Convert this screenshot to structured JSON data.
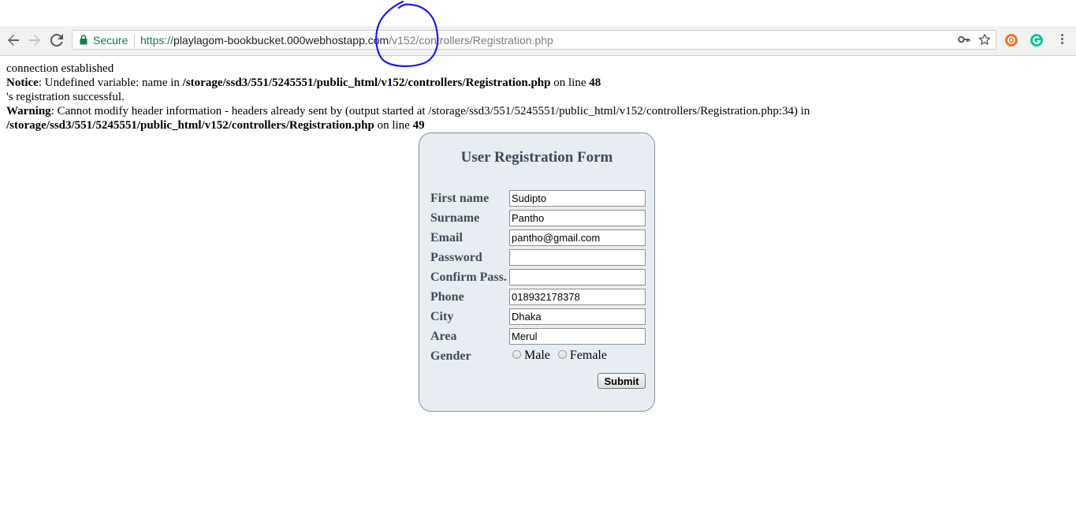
{
  "browser": {
    "secure_label": "Secure",
    "url_scheme": "https://",
    "url_host": "playlagom-bookbucket.000webhostapp.com",
    "url_path": "/v152/controllers/Registration.php"
  },
  "output": {
    "line1": "connection established",
    "notice_label": "Notice",
    "notice_text": ": Undefined variable: name in ",
    "notice_path": "/storage/ssd3/551/5245551/public_html/v152/controllers/Registration.php",
    "notice_on_line": " on line ",
    "notice_line_no": "48",
    "line3": "'s registration successful.",
    "warning_label": "Warning",
    "warning_text": ": Cannot modify header information - headers already sent by (output started at /storage/ssd3/551/5245551/public_html/v152/controllers/Registration.php:34) in",
    "warning_path": "/storage/ssd3/551/5245551/public_html/v152/controllers/Registration.php",
    "warning_on_line": " on line ",
    "warning_line_no": "49"
  },
  "form": {
    "title": "User Registration Form",
    "fields": [
      {
        "label": "First name",
        "value": "Sudipto"
      },
      {
        "label": "Surname",
        "value": "Pantho"
      },
      {
        "label": "Email",
        "value": "pantho@gmail.com"
      },
      {
        "label": "Password",
        "value": ""
      },
      {
        "label": "Confirm Pass.",
        "value": ""
      },
      {
        "label": "Phone",
        "value": "018932178378"
      },
      {
        "label": "City",
        "value": "Dhaka"
      },
      {
        "label": "Area",
        "value": "Merul"
      }
    ],
    "gender_label": "Gender",
    "gender_options": [
      "Male",
      "Female"
    ],
    "submit_label": "Submit"
  },
  "colors": {
    "annotation": "#1a1aff",
    "secure_green": "#0b8043",
    "form_bg": "#e8edf4"
  },
  "icons": [
    "back-arrow-icon",
    "forward-arrow-icon",
    "reload-icon",
    "lock-icon",
    "key-icon",
    "star-icon",
    "extension-icon",
    "grammarly-icon",
    "menu-icon"
  ]
}
